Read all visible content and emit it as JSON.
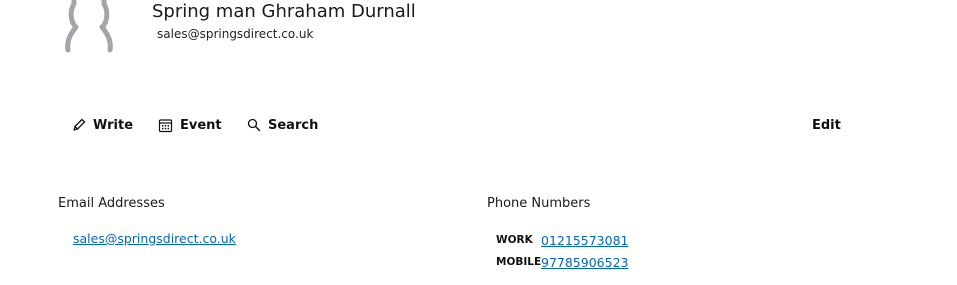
{
  "contact": {
    "name": "Spring man Ghraham Durnall",
    "email": "sales@springsdirect.co.uk",
    "avatar_icon": "person-placeholder-icon"
  },
  "toolbar": {
    "write_label": "Write",
    "event_label": "Event",
    "search_label": "Search",
    "edit_label": "Edit",
    "write_icon": "pencil-icon",
    "event_icon": "calendar-icon",
    "search_icon": "search-icon"
  },
  "sections": {
    "emails": {
      "heading": "Email Addresses",
      "items": [
        {
          "address": "sales@springsdirect.co.uk"
        }
      ]
    },
    "phones": {
      "heading": "Phone Numbers",
      "items": [
        {
          "type": "WORK",
          "number": "01215573081"
        },
        {
          "type": "MOBILE",
          "number": "97785906523"
        }
      ]
    }
  },
  "colors": {
    "link": "#0067c0",
    "avatar": "#a4a4ad"
  }
}
